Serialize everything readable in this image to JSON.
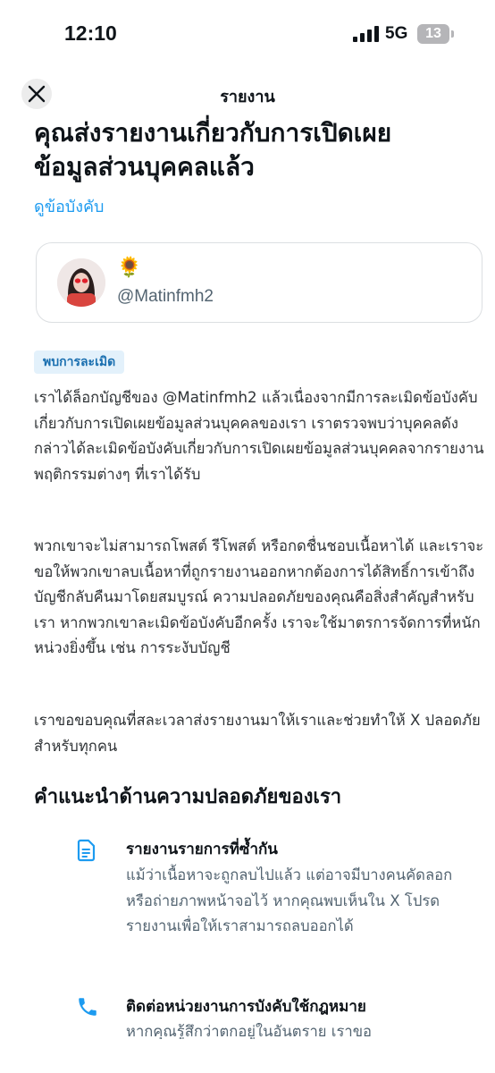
{
  "status_bar": {
    "time": "12:10",
    "network": "5G",
    "battery": "13"
  },
  "header": {
    "title": "รายงาน"
  },
  "page": {
    "title": "คุณส่งรายงานเกี่ยวกับการเปิดเผยข้อมูลส่วนบุคคลแล้ว",
    "rules_link": "ดูข้อบังคับ"
  },
  "user": {
    "display_name": "🌻",
    "handle": "@Matinfmh2"
  },
  "badge": "พบการละเมิด",
  "paragraphs": [
    "เราได้ล็อกบัญชีของ @Matinfmh2 แล้วเนื่องจากมีการละเมิดข้อบังคับเกี่ยวกับการเปิดเผยข้อมูลส่วนบุคคลของเรา เราตรวจพบว่าบุคคลดังกล่าวได้ละเมิดข้อบังคับเกี่ยวกับการเปิดเผยข้อมูลส่วนบุคคลจากรายงานพฤติกรรมต่างๆ ที่เราได้รับ",
    "พวกเขาจะไม่สามารถโพสต์ รีโพสต์ หรือกดชื่นชอบเนื้อหาได้ และเราจะขอให้พวกเขาลบเนื้อหาที่ถูกรายงานออกหากต้องการได้สิทธิ์การเข้าถึงบัญชีกลับคืนมาโดยสมบูรณ์ ความปลอดภัยของคุณคือสิ่งสำคัญสำหรับเรา หากพวกเขาละเมิดข้อบังคับอีกครั้ง เราจะใช้มาตรการจัดการที่หนักหน่วงยิ่งขึ้น เช่น การระงับบัญชี",
    "เราขอขอบคุณที่สละเวลาส่งรายงานมาให้เราและช่วยทำให้ X ปลอดภัยสำหรับทุกคน"
  ],
  "safety": {
    "heading": "คำแนะนำด้านความปลอดภัยของเรา",
    "tips": [
      {
        "icon": "document-icon",
        "title": "รายงานรายการที่ซ้ำกัน",
        "text": "แม้ว่าเนื้อหาจะถูกลบไปแล้ว แต่อาจมีบางคนคัดลอกหรือถ่ายภาพหน้าจอไว้ หากคุณพบเห็นใน X โปรดรายงานเพื่อให้เราสามารถลบออกได้"
      },
      {
        "icon": "phone-icon",
        "title": "ติดต่อหน่วยงานการบังคับใช้กฎหมาย",
        "text": "หากคุณรู้สึกว่าตกอยู่ในอันตราย เราขอ"
      }
    ]
  },
  "colors": {
    "accent": "#1d9bf0",
    "text": "#0f1419",
    "muted": "#536471",
    "badge_bg": "#e3f1fb"
  }
}
